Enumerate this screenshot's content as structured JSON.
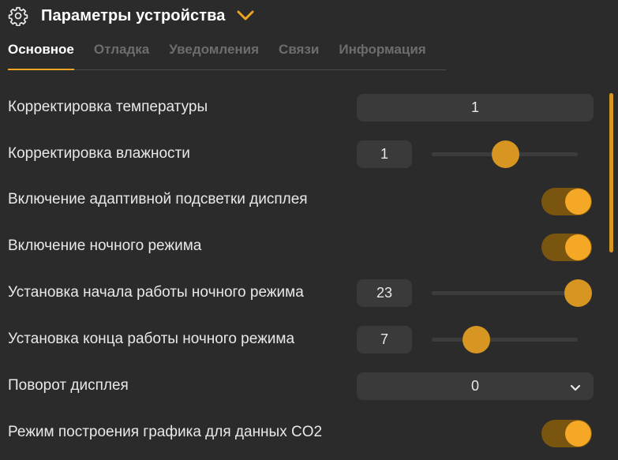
{
  "header": {
    "title": "Параметры устройства",
    "icon": "gear-icon",
    "dropdown_icon": "chevron-down-icon",
    "accent_color": "#f0a424"
  },
  "tabs": [
    {
      "label": "Основное",
      "active": true
    },
    {
      "label": "Отладка",
      "active": false
    },
    {
      "label": "Уведомления",
      "active": false
    },
    {
      "label": "Связи",
      "active": false
    },
    {
      "label": "Информация",
      "active": false
    }
  ],
  "settings": {
    "temp_correction": {
      "label": "Корректировка температуры",
      "value": "1"
    },
    "humidity_correction": {
      "label": "Корректировка влажности",
      "value": "1",
      "slider_fraction": 0.5
    },
    "adaptive_backlight": {
      "label": "Включение адаптивной подсветки дисплея",
      "enabled": true
    },
    "night_mode": {
      "label": "Включение ночного режима",
      "enabled": true
    },
    "night_start": {
      "label": "Установка начала работы ночного режима",
      "value": "23",
      "slider_fraction": 1.0
    },
    "night_end": {
      "label": "Установка конца работы ночного режима",
      "value": "7",
      "slider_fraction": 0.3
    },
    "display_rotation": {
      "label": "Поворот дисплея",
      "value": "0"
    },
    "co2_graph_mode": {
      "label": "Режим построения графика для данных CO2",
      "enabled": true
    }
  }
}
